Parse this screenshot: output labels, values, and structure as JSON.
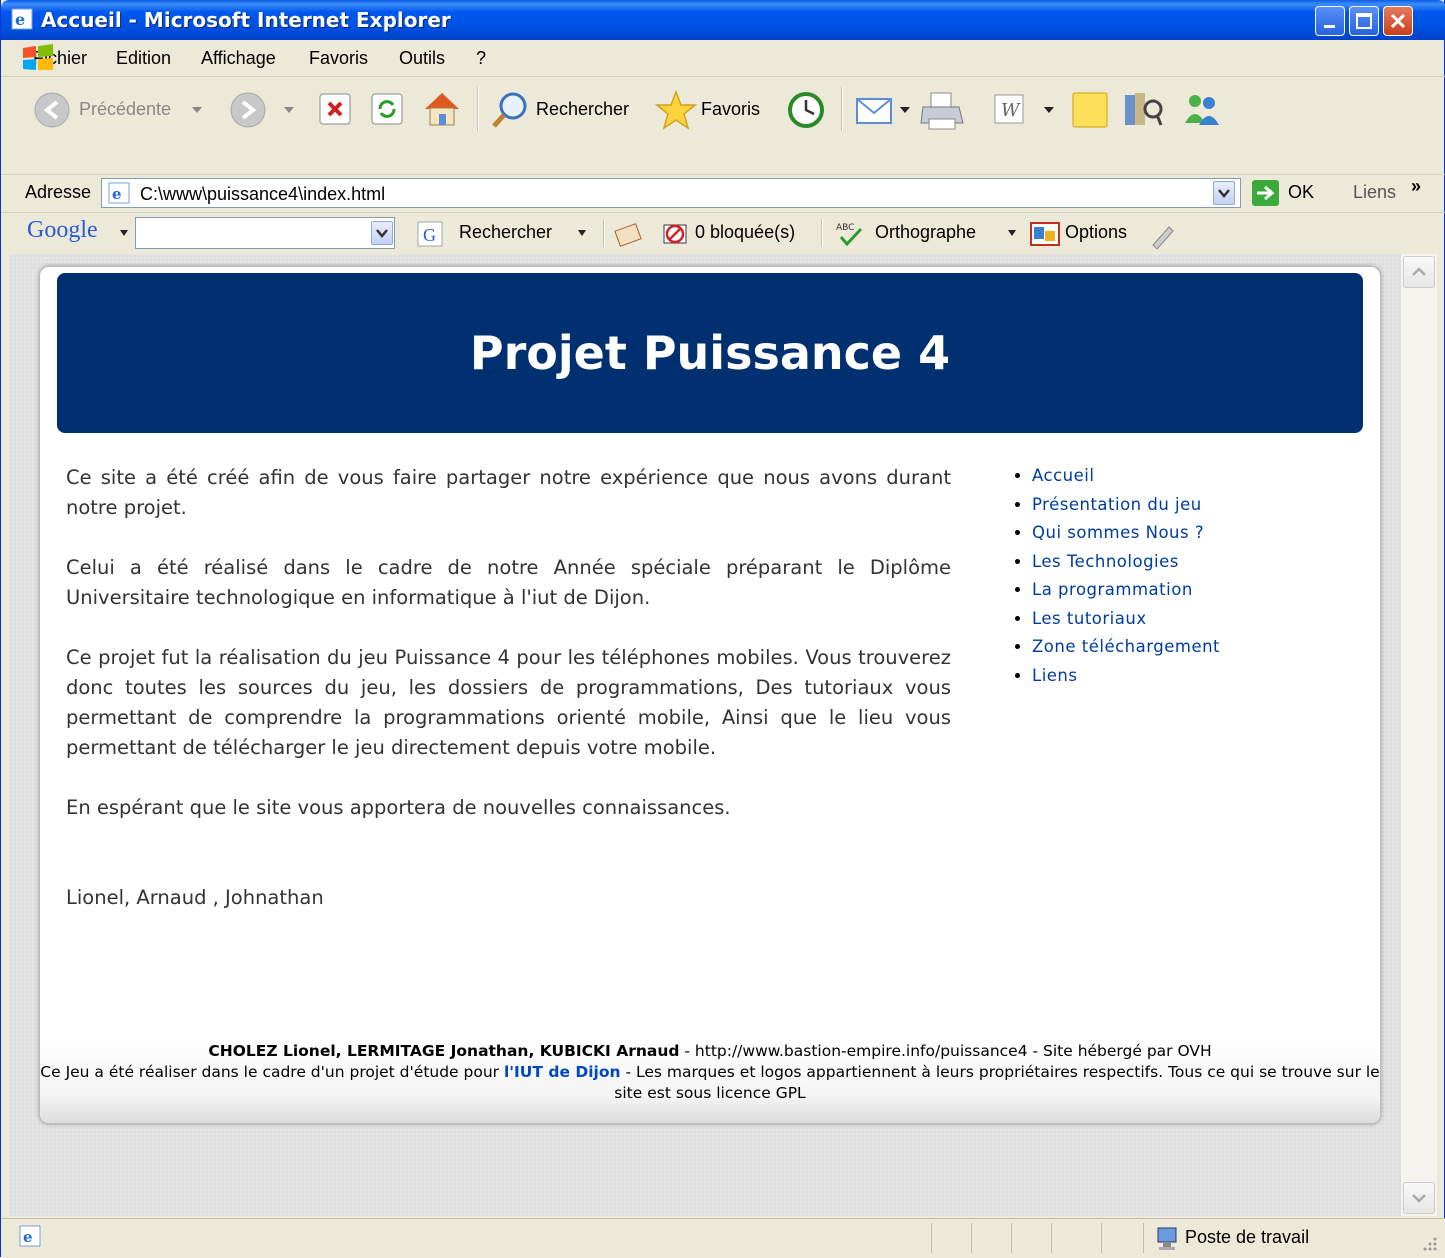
{
  "window": {
    "title": "Accueil - Microsoft Internet Explorer"
  },
  "menu": {
    "items": [
      "Fichier",
      "Edition",
      "Affichage",
      "Favoris",
      "Outils",
      "?"
    ]
  },
  "toolbar": {
    "back_label": "Précédente",
    "search_label": "Rechercher",
    "favorites_label": "Favoris"
  },
  "address": {
    "label": "Adresse",
    "url": "C:\\www\\puissance4\\index.html",
    "go_label": "OK",
    "links_label": "Liens",
    "links_more": "»"
  },
  "googlebar": {
    "logo": "Google",
    "search_value": "",
    "search_label": "Rechercher",
    "blocked_label": "0 bloquée(s)",
    "spell_label": "Orthographe",
    "options_label": "Options"
  },
  "page": {
    "banner_title": "Projet Puissance 4",
    "paragraphs": [
      "Ce site a été créé afin de vous faire partager notre expérience que nous avons durant notre projet.",
      "Celui a été réalisé dans le cadre de notre Année spéciale préparant le Diplôme Universitaire technologique en informatique à l'iut de Dijon.",
      "Ce projet fut la réalisation du jeu Puissance 4 pour les téléphones mobiles. Vous trouverez donc toutes les sources du jeu, les dossiers de programmations, Des tutoriaux vous permettant de comprendre la programmations orienté mobile, Ainsi que le lieu vous permettant de télécharger le jeu directement depuis votre mobile.",
      "En espérant que le site vous apportera de nouvelles connaissances."
    ],
    "signature": "Lionel, Arnaud , Johnathan",
    "nav": [
      "Accueil",
      "Présentation du jeu",
      "Qui sommes Nous ?",
      "Les Technologies",
      "La programmation",
      "Les tutoriaux",
      "Zone téléchargement",
      "Liens"
    ],
    "footer": {
      "authors": "CHOLEZ Lionel, LERMITAGE Jonathan, KUBICKI Arnaud",
      "line1_rest": " - http://www.bastion-empire.info/puissance4 - Site hébergé par OVH",
      "line2_before": "Ce Jeu a été réaliser dans le cadre d'un projet d'étude pour ",
      "iut_link": "l'IUT de Dijon",
      "line2_after": " - Les marques et logos appartiennent à leurs propriétaires respectifs. Tous ce qui se trouve sur le site est sous licence GPL"
    }
  },
  "status": {
    "zone": "Poste de travail"
  },
  "colors": {
    "banner": "#003070",
    "nav_link": "#003C9E",
    "titlebar": "#0058EE",
    "iut_link": "#0048C0"
  }
}
